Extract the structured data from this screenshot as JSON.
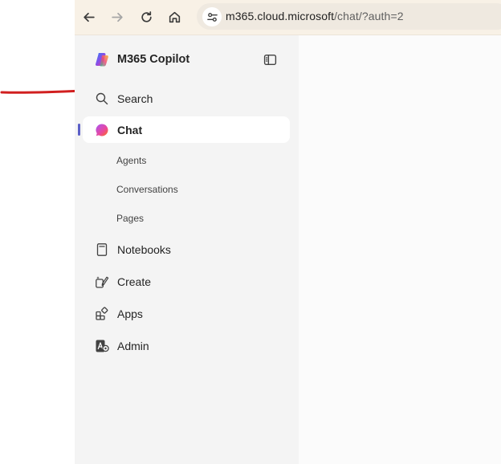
{
  "browser": {
    "url_host": "m365.cloud.microsoft",
    "url_path": "/chat/?auth=2",
    "icons": [
      "back-arrow-icon",
      "forward-arrow-icon",
      "reload-icon",
      "home-icon",
      "site-settings-icon"
    ]
  },
  "sidebar": {
    "app_title": "M365 Copilot",
    "search_label": "Search",
    "chat_label": "Chat",
    "chat_subitems": [
      "Agents",
      "Conversations",
      "Pages"
    ],
    "notebooks_label": "Notebooks",
    "create_label": "Create",
    "apps_label": "Apps",
    "admin_label": "Admin"
  },
  "colors": {
    "annotation_red": "#d11f1f",
    "active_indicator": "#5b5fc7",
    "browser_bar": "#f8f1e6",
    "sidebar_bg": "#f4f4f4"
  }
}
